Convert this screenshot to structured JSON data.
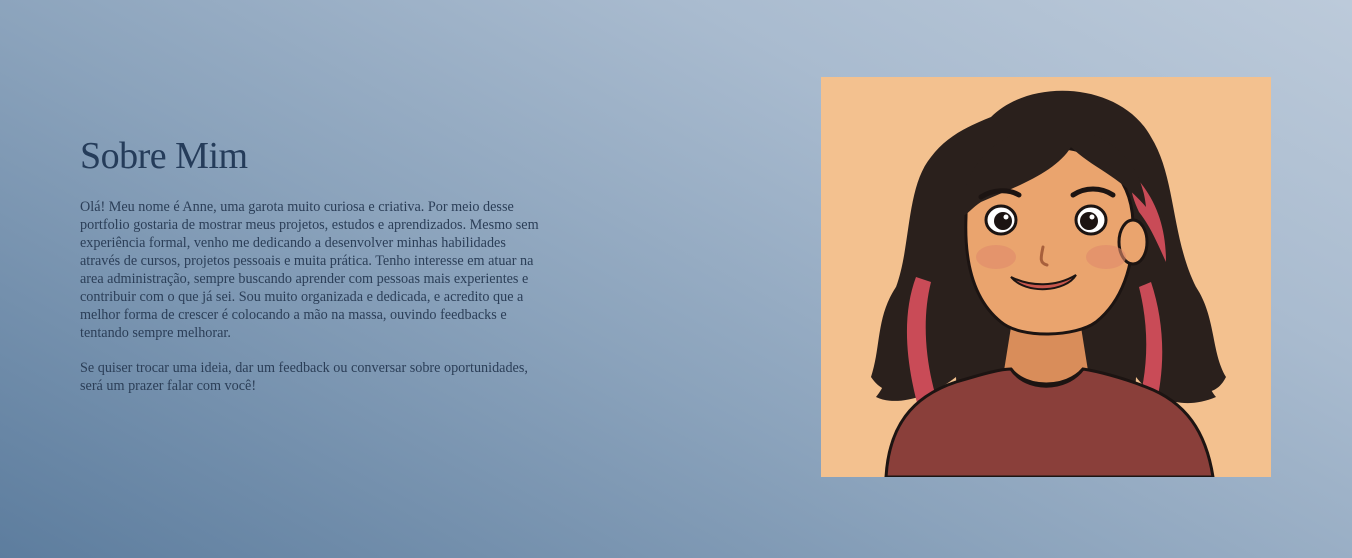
{
  "about": {
    "title": "Sobre Mim",
    "paragraphs": [
      "Olá! Meu nome é Anne, uma garota muito curiosa e criativa. Por meio desse portfolio gostaria de mostrar meus projetos, estudos e aprendizados. Mesmo sem experiência formal, venho me dedicando a desenvolver minhas habilidades através de cursos, projetos pessoais e muita prática. Tenho interesse em atuar na area administração, sempre buscando aprender com pessoas mais experientes e contribuir com o que já sei. Sou muito organizada e dedicada, e acredito que a melhor forma de crescer é colocando a mão na massa, ouvindo feedbacks e tentando sempre melhorar.",
      "Se quiser trocar uma ideia, dar um feedback ou conversar sobre oportunidades, será um prazer falar com você!"
    ],
    "portrait": {
      "icon": "illustrated-avatar",
      "colors": {
        "background": "#f3c18f",
        "hair": "#2a201c",
        "hair_highlight": "#c94b57",
        "skin": "#eaa46e",
        "shirt": "#8a3f3a"
      }
    }
  },
  "colors": {
    "background_start": "#5d7d9e",
    "background_end": "#bccada",
    "title": "#253c5a",
    "body_text": "#2b3e57"
  }
}
